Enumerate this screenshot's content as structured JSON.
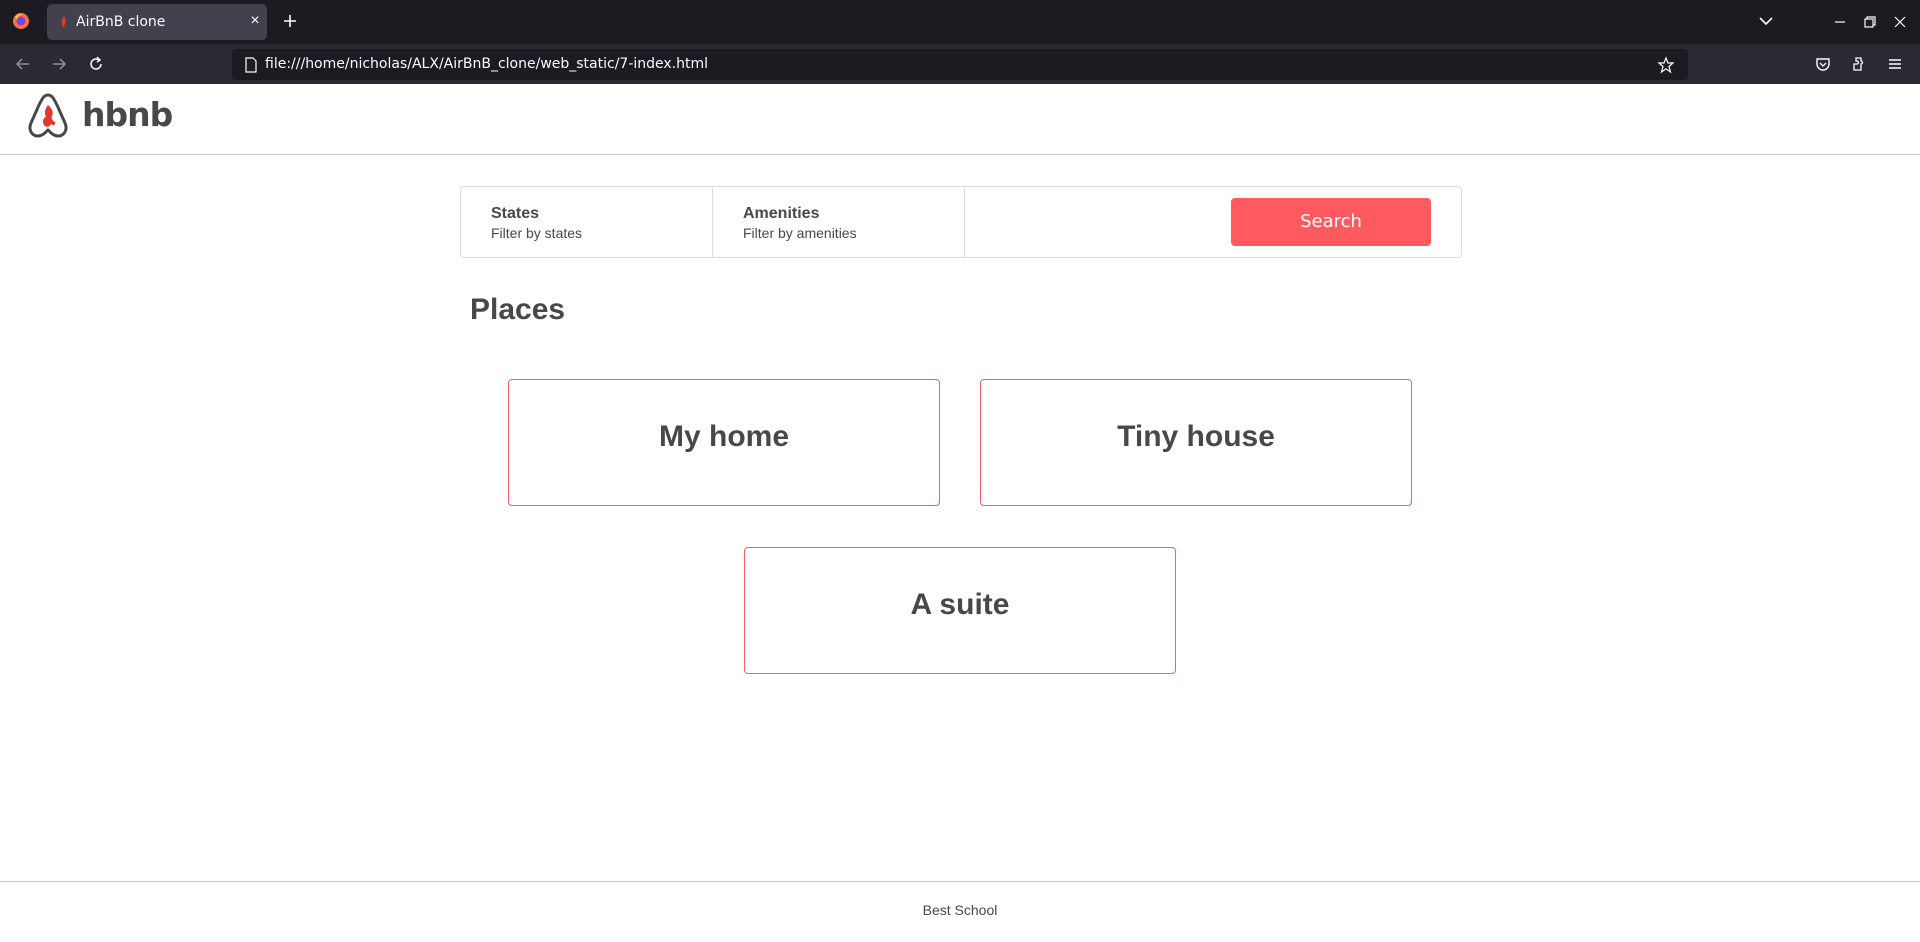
{
  "browser": {
    "tab_title": "AirBnB clone",
    "url": "file:///home/nicholas/ALX/AirBnB_clone/web_static/7-index.html",
    "icons": [
      "firefox-icon",
      "close-icon",
      "plus-icon",
      "chevron-down-icon",
      "minimize-icon",
      "restore-icon",
      "close-icon",
      "back-icon",
      "forward-icon",
      "reload-icon",
      "page-icon",
      "star-icon",
      "pocket-icon",
      "extensions-icon",
      "menu-icon"
    ]
  },
  "header": {
    "logo_text": "hbnb"
  },
  "filters": {
    "states": {
      "title": "States",
      "subtitle": "Filter by states"
    },
    "amenities": {
      "title": "Amenities",
      "subtitle": "Filter by amenities"
    },
    "search_label": "Search"
  },
  "places": {
    "title": "Places",
    "items": [
      {
        "name": "My home"
      },
      {
        "name": "Tiny house"
      },
      {
        "name": "A suite"
      }
    ]
  },
  "footer": {
    "text": "Best School"
  },
  "colors": {
    "accent": "#ff5a5f",
    "text": "#484848",
    "chrome_dark": "#1c1b22",
    "chrome_toolbar": "#2b2a33"
  }
}
